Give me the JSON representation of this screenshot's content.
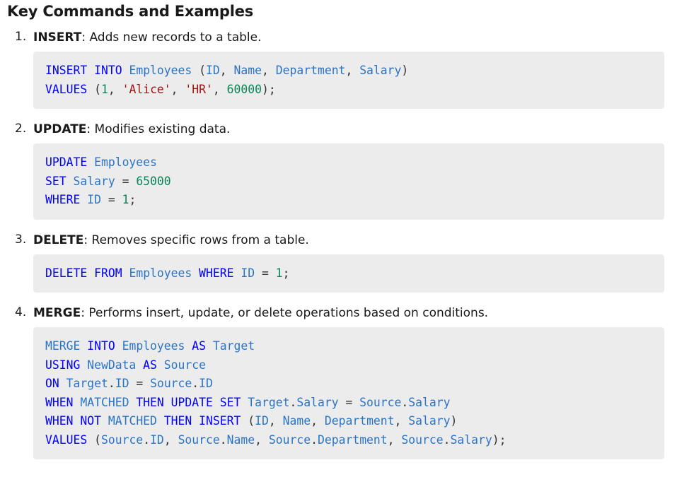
{
  "heading": "Key Commands and Examples",
  "commands": [
    {
      "number": "1.",
      "name": "INSERT",
      "description": ": Adds new records to a table.",
      "code": [
        [
          [
            "kw",
            "INSERT"
          ],
          [
            "sp",
            " "
          ],
          [
            "kw",
            "INTO"
          ],
          [
            "sp",
            " "
          ],
          [
            "id",
            "Employees"
          ],
          [
            "sp",
            " "
          ],
          [
            "pun",
            "("
          ],
          [
            "id",
            "ID"
          ],
          [
            "pun",
            ", "
          ],
          [
            "id",
            "Name"
          ],
          [
            "pun",
            ", "
          ],
          [
            "id",
            "Department"
          ],
          [
            "pun",
            ", "
          ],
          [
            "id",
            "Salary"
          ],
          [
            "pun",
            ")"
          ]
        ],
        [
          [
            "kw",
            "VALUES"
          ],
          [
            "sp",
            " "
          ],
          [
            "pun",
            "("
          ],
          [
            "num",
            "1"
          ],
          [
            "pun",
            ", "
          ],
          [
            "str",
            "'Alice'"
          ],
          [
            "pun",
            ", "
          ],
          [
            "str",
            "'HR'"
          ],
          [
            "pun",
            ", "
          ],
          [
            "num",
            "60000"
          ],
          [
            "pun",
            ");"
          ]
        ]
      ]
    },
    {
      "number": "2.",
      "name": "UPDATE",
      "description": ": Modifies existing data.",
      "code": [
        [
          [
            "kw",
            "UPDATE"
          ],
          [
            "sp",
            " "
          ],
          [
            "id",
            "Employees"
          ]
        ],
        [
          [
            "kw",
            "SET"
          ],
          [
            "sp",
            " "
          ],
          [
            "id",
            "Salary"
          ],
          [
            "pun",
            " = "
          ],
          [
            "num",
            "65000"
          ]
        ],
        [
          [
            "kw",
            "WHERE"
          ],
          [
            "sp",
            " "
          ],
          [
            "id",
            "ID"
          ],
          [
            "pun",
            " = "
          ],
          [
            "num",
            "1"
          ],
          [
            "pun",
            ";"
          ]
        ]
      ]
    },
    {
      "number": "3.",
      "name": "DELETE",
      "description": ": Removes specific rows from a table.",
      "code": [
        [
          [
            "kw",
            "DELETE"
          ],
          [
            "sp",
            " "
          ],
          [
            "kw",
            "FROM"
          ],
          [
            "sp",
            " "
          ],
          [
            "id",
            "Employees"
          ],
          [
            "sp",
            " "
          ],
          [
            "kw",
            "WHERE"
          ],
          [
            "sp",
            " "
          ],
          [
            "id",
            "ID"
          ],
          [
            "pun",
            " = "
          ],
          [
            "num",
            "1"
          ],
          [
            "pun",
            ";"
          ]
        ]
      ]
    },
    {
      "number": "4.",
      "name": "MERGE",
      "description": ": Performs insert, update, or delete operations based on conditions.",
      "code": [
        [
          [
            "id",
            "MERGE"
          ],
          [
            "sp",
            " "
          ],
          [
            "kw",
            "INTO"
          ],
          [
            "sp",
            " "
          ],
          [
            "id",
            "Employees"
          ],
          [
            "sp",
            " "
          ],
          [
            "kw",
            "AS"
          ],
          [
            "sp",
            " "
          ],
          [
            "id",
            "Target"
          ]
        ],
        [
          [
            "kw",
            "USING"
          ],
          [
            "sp",
            " "
          ],
          [
            "id",
            "NewData"
          ],
          [
            "sp",
            " "
          ],
          [
            "kw",
            "AS"
          ],
          [
            "sp",
            " "
          ],
          [
            "id",
            "Source"
          ]
        ],
        [
          [
            "kw",
            "ON"
          ],
          [
            "sp",
            " "
          ],
          [
            "id",
            "Target"
          ],
          [
            "pun",
            "."
          ],
          [
            "id",
            "ID"
          ],
          [
            "pun",
            " = "
          ],
          [
            "id",
            "Source"
          ],
          [
            "pun",
            "."
          ],
          [
            "id",
            "ID"
          ]
        ],
        [
          [
            "kw",
            "WHEN"
          ],
          [
            "sp",
            " "
          ],
          [
            "id",
            "MATCHED"
          ],
          [
            "sp",
            " "
          ],
          [
            "kw",
            "THEN"
          ],
          [
            "sp",
            " "
          ],
          [
            "kw",
            "UPDATE"
          ],
          [
            "sp",
            " "
          ],
          [
            "kw",
            "SET"
          ],
          [
            "sp",
            " "
          ],
          [
            "id",
            "Target"
          ],
          [
            "pun",
            "."
          ],
          [
            "id",
            "Salary"
          ],
          [
            "pun",
            " = "
          ],
          [
            "id",
            "Source"
          ],
          [
            "pun",
            "."
          ],
          [
            "id",
            "Salary"
          ]
        ],
        [
          [
            "kw",
            "WHEN"
          ],
          [
            "sp",
            " "
          ],
          [
            "kw",
            "NOT"
          ],
          [
            "sp",
            " "
          ],
          [
            "id",
            "MATCHED"
          ],
          [
            "sp",
            " "
          ],
          [
            "kw",
            "THEN"
          ],
          [
            "sp",
            " "
          ],
          [
            "kw",
            "INSERT"
          ],
          [
            "sp",
            " "
          ],
          [
            "pun",
            "("
          ],
          [
            "id",
            "ID"
          ],
          [
            "pun",
            ", "
          ],
          [
            "id",
            "Name"
          ],
          [
            "pun",
            ", "
          ],
          [
            "id",
            "Department"
          ],
          [
            "pun",
            ", "
          ],
          [
            "id",
            "Salary"
          ],
          [
            "pun",
            ")"
          ]
        ],
        [
          [
            "kw",
            "VALUES"
          ],
          [
            "sp",
            " "
          ],
          [
            "pun",
            "("
          ],
          [
            "id",
            "Source"
          ],
          [
            "pun",
            "."
          ],
          [
            "id",
            "ID"
          ],
          [
            "pun",
            ", "
          ],
          [
            "id",
            "Source"
          ],
          [
            "pun",
            "."
          ],
          [
            "id",
            "Name"
          ],
          [
            "pun",
            ", "
          ],
          [
            "id",
            "Source"
          ],
          [
            "pun",
            "."
          ],
          [
            "id",
            "Department"
          ],
          [
            "pun",
            ", "
          ],
          [
            "id",
            "Source"
          ],
          [
            "pun",
            "."
          ],
          [
            "id",
            "Salary"
          ],
          [
            "pun",
            ");"
          ]
        ]
      ]
    }
  ],
  "colors": {
    "keyword": "#0000ff",
    "identifier": "#2b74c5",
    "string": "#a31515",
    "number": "#098658",
    "code_background": "#ececec"
  }
}
